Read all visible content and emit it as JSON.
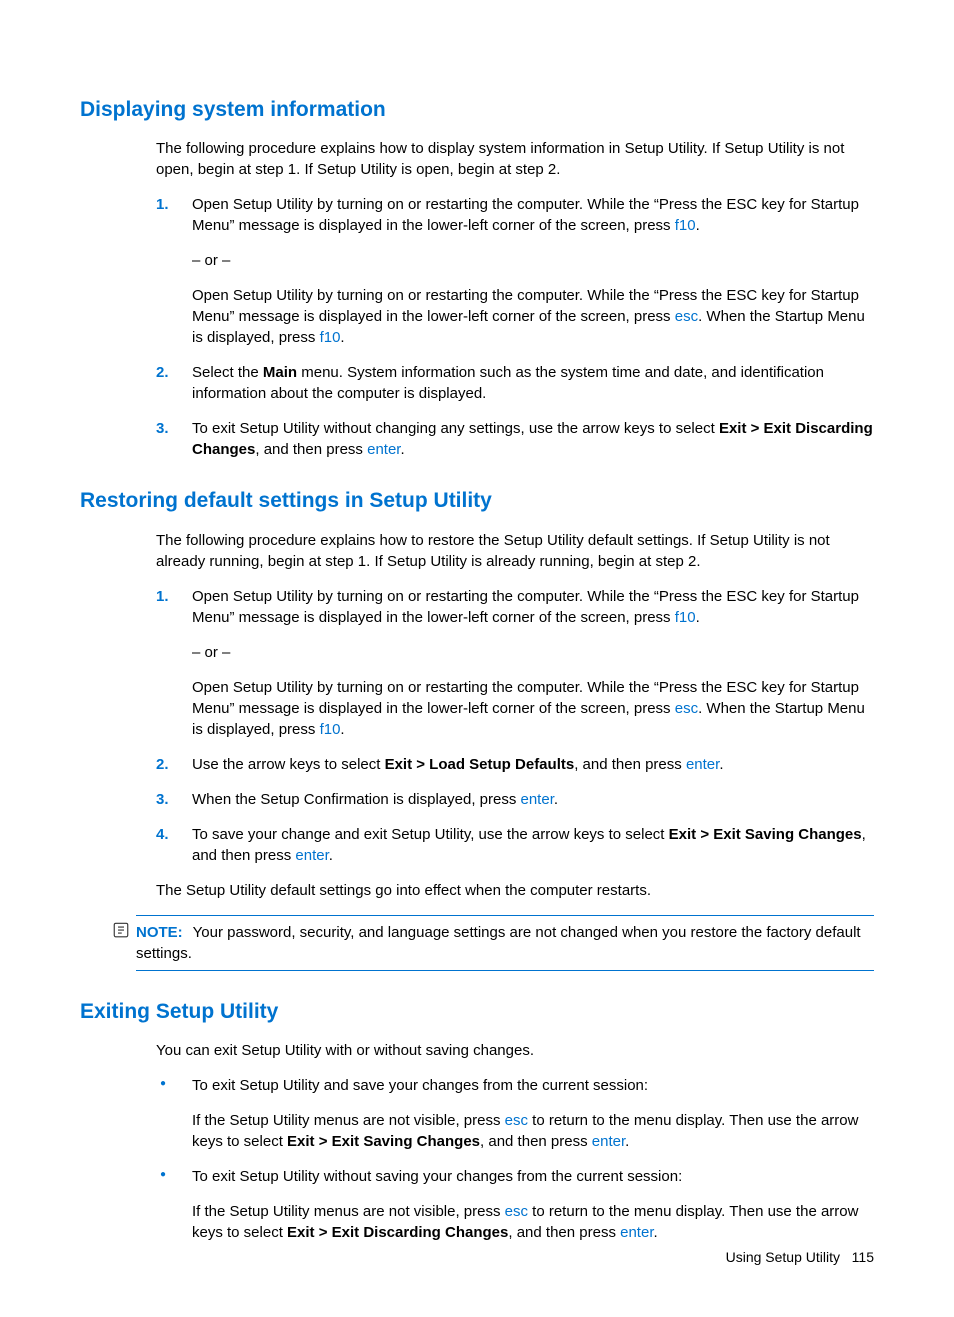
{
  "sections": {
    "s1": {
      "heading": "Displaying system information",
      "intro": "The following procedure explains how to display system information in Setup Utility. If Setup Utility is not open, begin at step 1. If Setup Utility is open, begin at step 2.",
      "step1a_pre": "Open Setup Utility by turning on or restarting the computer. While the “Press the ESC key for Startup Menu” message is displayed in the lower-left corner of the screen, press ",
      "step1a_key": "f10",
      "step1a_post": ".",
      "or": "– or –",
      "step1b_pre": "Open Setup Utility by turning on or restarting the computer. While the “Press the ESC key for Startup Menu” message is displayed in the lower-left corner of the screen, press ",
      "step1b_key1": "esc",
      "step1b_mid": ". When the Startup Menu is displayed, press ",
      "step1b_key2": "f10",
      "step1b_post": ".",
      "step2_pre": "Select the ",
      "step2_bold": "Main",
      "step2_post": " menu. System information such as the system time and date, and identification information about the computer is displayed.",
      "step3_pre": "To exit Setup Utility without changing any settings, use the arrow keys to select ",
      "step3_bold": "Exit > Exit Discarding Changes",
      "step3_mid": ", and then press ",
      "step3_key": "enter",
      "step3_post": "."
    },
    "s2": {
      "heading": "Restoring default settings in Setup Utility",
      "intro": "The following procedure explains how to restore the Setup Utility default settings. If Setup Utility is not already running, begin at step 1. If Setup Utility is already running, begin at step 2.",
      "step1a_pre": "Open Setup Utility by turning on or restarting the computer. While the “Press the ESC key for Startup Menu” message is displayed in the lower-left corner of the screen, press ",
      "step1a_key": "f10",
      "step1a_post": ".",
      "or": "– or –",
      "step1b_pre": "Open Setup Utility by turning on or restarting the computer. While the “Press the ESC key for Startup Menu” message is displayed in the lower-left corner of the screen, press ",
      "step1b_key1": "esc",
      "step1b_mid": ". When the Startup Menu is displayed, press ",
      "step1b_key2": "f10",
      "step1b_post": ".",
      "step2_pre": "Use the arrow keys to select ",
      "step2_bold": "Exit > Load Setup Defaults",
      "step2_mid": ", and then press ",
      "step2_key": "enter",
      "step2_post": ".",
      "step3_pre": "When the Setup Confirmation is displayed, press ",
      "step3_key": "enter",
      "step3_post": ".",
      "step4_pre": "To save your change and exit Setup Utility, use the arrow keys to select ",
      "step4_bold": "Exit > Exit Saving Changes",
      "step4_mid": ", and then press ",
      "step4_key": "enter",
      "step4_post": ".",
      "outro": "The Setup Utility default settings go into effect when the computer restarts.",
      "note_label": "NOTE:",
      "note_text": "Your password, security, and language settings are not changed when you restore the factory default settings."
    },
    "s3": {
      "heading": "Exiting Setup Utility",
      "intro": "You can exit Setup Utility with or without saving changes.",
      "b1_lead": "To exit Setup Utility and save your changes from the current session:",
      "b1_pre": "If the Setup Utility menus are not visible, press ",
      "b1_key1": "esc",
      "b1_mid1": " to return to the menu display. Then use the arrow keys to select ",
      "b1_bold": "Exit > Exit Saving Changes",
      "b1_mid2": ", and then press ",
      "b1_key2": "enter",
      "b1_post": ".",
      "b2_lead": "To exit Setup Utility without saving your changes from the current session:",
      "b2_pre": "If the Setup Utility menus are not visible, press ",
      "b2_key1": "esc",
      "b2_mid1": " to return to the menu display. Then use the arrow keys to select ",
      "b2_bold": "Exit > Exit Discarding Changes",
      "b2_mid2": ", and then press ",
      "b2_key2": "enter",
      "b2_post": "."
    }
  },
  "nums": {
    "n1": "1.",
    "n2": "2.",
    "n3": "3.",
    "n4": "4."
  },
  "footer": {
    "label": "Using Setup Utility",
    "page": "115"
  }
}
